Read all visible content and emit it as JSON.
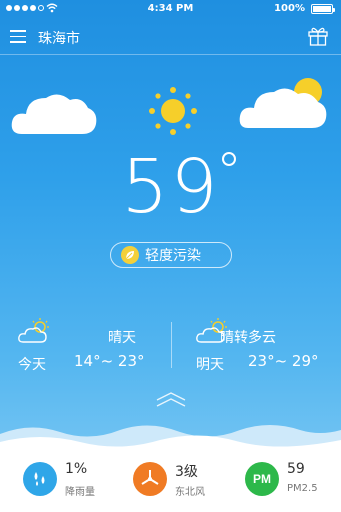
{
  "status_bar": {
    "time": "4:34 PM",
    "battery": "100%"
  },
  "header": {
    "city": "珠海市",
    "menu_icon": "hamburger-menu-icon",
    "gift_icon": "gift-icon"
  },
  "current": {
    "temperature": "59",
    "air_quality": "轻度污染",
    "air_quality_icon": "leaf-icon"
  },
  "forecast": [
    {
      "day": "今天",
      "condition": "晴天",
      "range": "14°~ 23°",
      "icon": "partly-cloudy-icon"
    },
    {
      "day": "明天",
      "condition": "晴转多云",
      "range": "23°~ 29°",
      "icon": "partly-cloudy-icon"
    }
  ],
  "stats": {
    "rain": {
      "value": "1%",
      "label": "降雨量",
      "color": "#2fa6e8",
      "icon": "raindrops-icon"
    },
    "wind": {
      "value": "3级",
      "label": "东北风",
      "color": "#f07b24",
      "icon": "fan-icon"
    },
    "pm": {
      "value": "59",
      "label": "PM2.5",
      "badge": "PM",
      "color": "#2db84a"
    }
  },
  "colors": {
    "sky_top": "#1f8fe0",
    "sky_bottom": "#86cdf4",
    "sun": "#f6cf2a"
  }
}
